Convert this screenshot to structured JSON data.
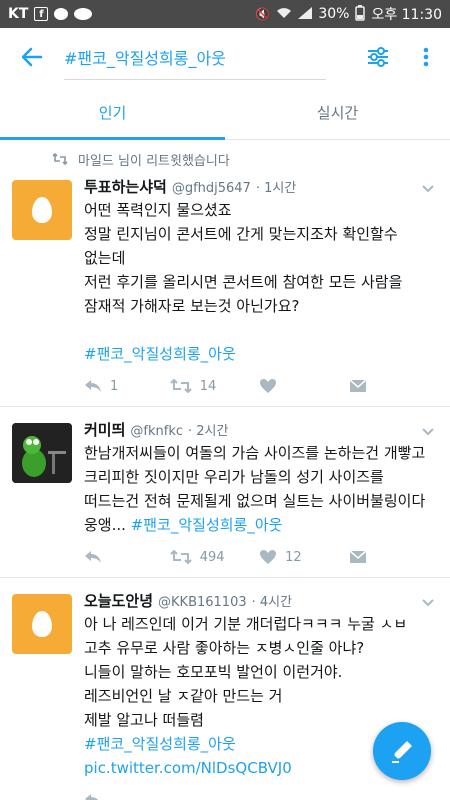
{
  "status_bar": {
    "carrier": "KT",
    "battery": "30%",
    "time": "오후 11:30"
  },
  "header": {
    "query": "#팬코_악질성희롱_아웃"
  },
  "tabs": [
    {
      "label": "인기"
    },
    {
      "label": "실시간"
    }
  ],
  "tweets": [
    {
      "retweeted_by": "마일드 님이 리트윗했습니다",
      "name": "투표하는샤덕",
      "handle": "@gfhdj5647",
      "time": "· 1시간",
      "text": "어떤 폭력인지 물으셨죠\n정말 린지님이 콘서트에 간게 맞는지조차 확인할수 없는데\n저런 후기를 올리시면 콘서트에 참여한 모든 사람을\n잠재적 가해자로 보는것 아닌가요?\n\n",
      "hashtag": "#팬코_악질성희롱_아웃",
      "reply_count": "1",
      "retweet_count": "14",
      "like_count": ""
    },
    {
      "name": "커미띄",
      "handle": "@fknfkc",
      "time": "· 2시간",
      "text": "한남개저씨들이 여돌의 가슴 사이즈를 논하는건 개빻고 크리피한 짓이지만 우리가 남돌의 성기 사이즈를 떠드는건 전혀 문제될게 없으며 실트는 사이버불링이다 웅앵... ",
      "hashtag": "#팬코_악질성희롱_아웃",
      "reply_count": "",
      "retweet_count": "494",
      "like_count": "12"
    },
    {
      "name": "오늘도안녕",
      "handle": "@KKB161103",
      "time": "· 4시간",
      "text": "아 나 레즈인데 이거 기분 개더럽다ㅋㅋㅋ 누굴 ㅅㅂ 고추 유무로 사람 좋아하는 ㅈ병ㅅ인줄 아냐?\n니들이 말하는 호모포빅 발언이 이런거야.\n레즈비언인 날 ㅈ같아 만드는 거\n제발 알고나 떠들렴\n",
      "hashtag": "#팬코_악질성희롱_아웃",
      "link": " pic.twitter.com/NlDsQCBVJ0"
    }
  ],
  "colors": {
    "accent": "#1da1f2",
    "egg_avatar": "#f5ab35",
    "muted": "#657786",
    "status_bar": "#4a4a4a"
  },
  "icons": [
    "back-arrow-icon",
    "filter-sliders-icon",
    "overflow-menu-icon",
    "retweet-icon",
    "reply-icon",
    "heart-icon",
    "dm-envelope-icon",
    "caret-down-icon",
    "compose-icon"
  ]
}
